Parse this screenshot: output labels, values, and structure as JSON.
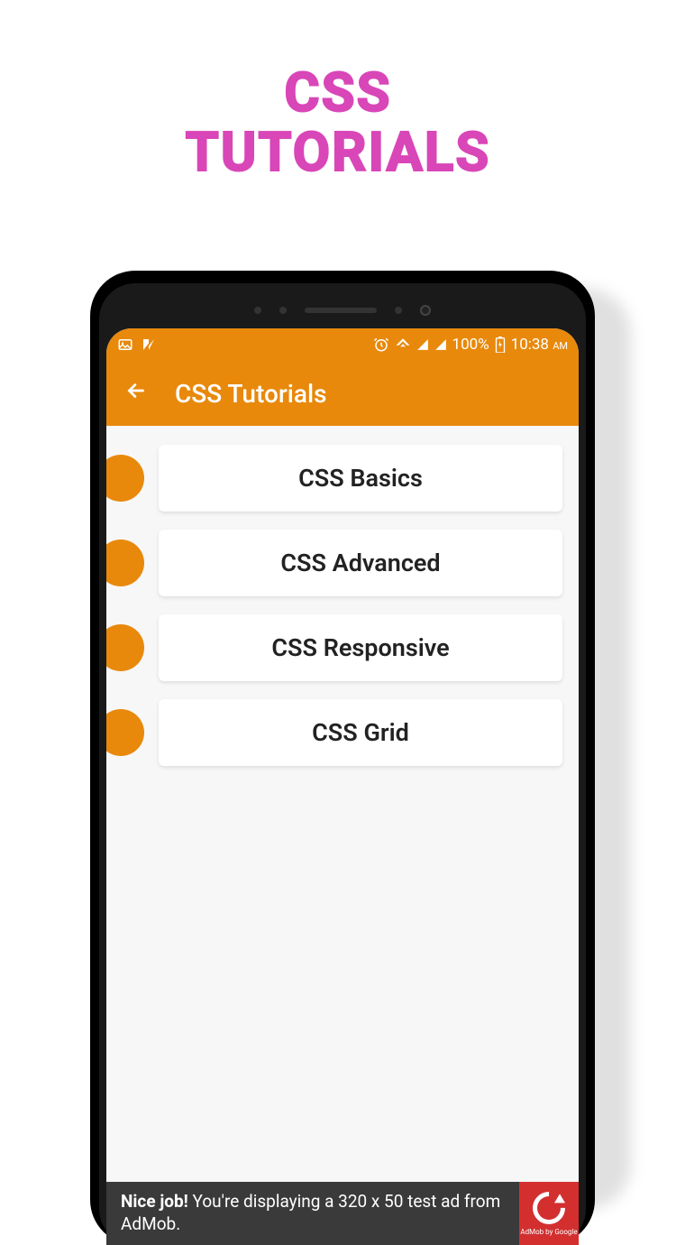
{
  "promo": {
    "line1": "CSS",
    "line2": "TUTORIALS"
  },
  "status": {
    "battery": "100%",
    "time": "10:38",
    "ampm": "AM"
  },
  "appbar": {
    "title": "CSS Tutorials"
  },
  "items": [
    {
      "label": "CSS Basics"
    },
    {
      "label": "CSS Advanced"
    },
    {
      "label": "CSS Responsive"
    },
    {
      "label": "CSS Grid"
    }
  ],
  "ad": {
    "bold": "Nice job!",
    "text": " You're displaying a 320 x 50 test ad from AdMob.",
    "brand": "AdMob by Google"
  },
  "colors": {
    "accent": "#e8890c",
    "promo": "#d946b8",
    "adRed": "#d32f2f"
  }
}
